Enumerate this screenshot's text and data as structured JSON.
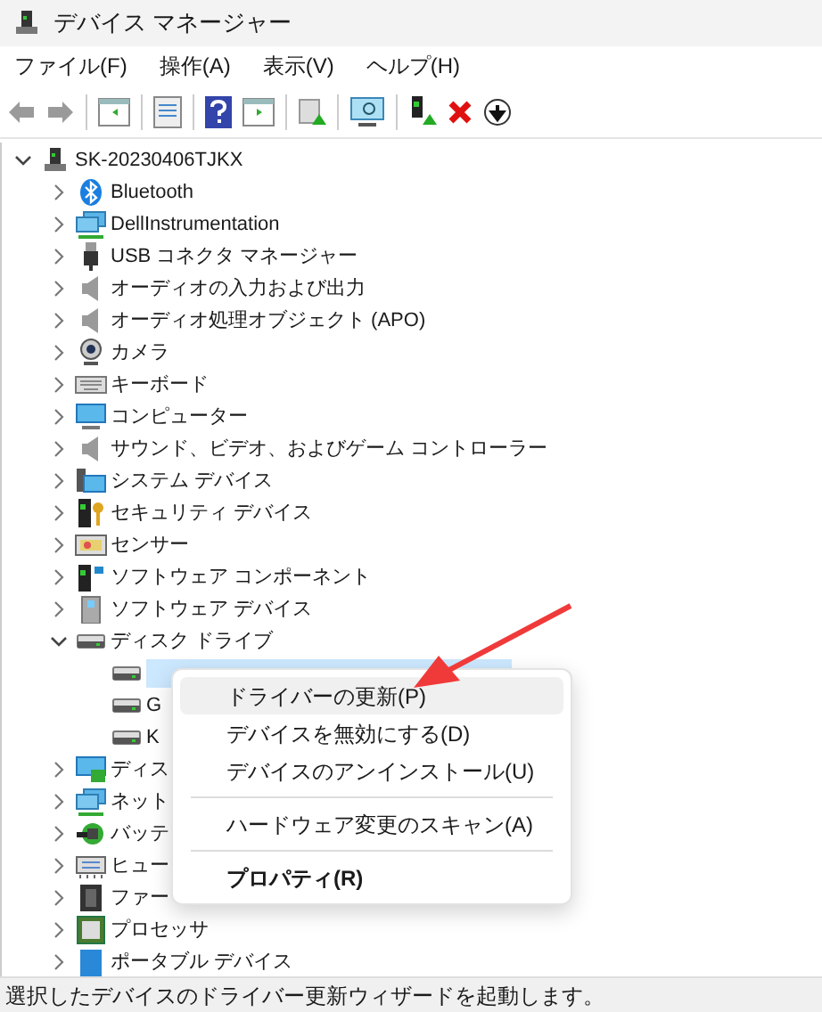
{
  "window": {
    "title": "デバイス マネージャー"
  },
  "menu_bar": [
    "ファイル(F)",
    "操作(A)",
    "表示(V)",
    "ヘルプ(H)"
  ],
  "tree": {
    "label": "SK-20230406TJKX",
    "expanded": true,
    "children": [
      {
        "label": "Bluetooth",
        "expanded": false
      },
      {
        "label": "DellInstrumentation",
        "expanded": false
      },
      {
        "label": "USB コネクタ マネージャー",
        "expanded": false
      },
      {
        "label": "オーディオの入力および出力",
        "expanded": false
      },
      {
        "label": "オーディオ処理オブジェクト (APO)",
        "expanded": false
      },
      {
        "label": "カメラ",
        "expanded": false
      },
      {
        "label": "キーボード",
        "expanded": false
      },
      {
        "label": "コンピューター",
        "expanded": false
      },
      {
        "label": "サウンド、ビデオ、およびゲーム コントローラー",
        "expanded": false
      },
      {
        "label": "システム デバイス",
        "expanded": false
      },
      {
        "label": "セキュリティ デバイス",
        "expanded": false
      },
      {
        "label": "センサー",
        "expanded": false
      },
      {
        "label": "ソフトウェア コンポーネント",
        "expanded": false
      },
      {
        "label": "ソフトウェア デバイス",
        "expanded": false
      },
      {
        "label": "ディスク ドライブ",
        "expanded": true,
        "children": [
          {
            "selected": true
          },
          {
            "label": "G",
            "selected": false
          },
          {
            "label": "K",
            "selected": false
          }
        ]
      },
      {
        "label": "ディス",
        "expanded": false
      },
      {
        "label": "ネット",
        "expanded": false
      },
      {
        "label": "バッテ",
        "expanded": false
      },
      {
        "label": "ヒュー",
        "expanded": false
      },
      {
        "label": "ファー",
        "expanded": false
      },
      {
        "label": "プロセッサ",
        "expanded": false
      },
      {
        "label": "ポータブル デバイス",
        "expanded": false
      }
    ]
  },
  "context_menu": [
    {
      "kind": "item",
      "label": "ドライバーの更新(P)",
      "selected": true
    },
    {
      "kind": "item",
      "label": "デバイスを無効にする(D)",
      "selected": false
    },
    {
      "kind": "item",
      "label": "デバイスのアンインストール(U)",
      "selected": false
    },
    {
      "kind": "separator"
    },
    {
      "kind": "item",
      "label": "ハードウェア変更のスキャン(A)",
      "selected": false
    },
    {
      "kind": "separator"
    },
    {
      "kind": "default",
      "label": "プロパティ(R)",
      "selected": false
    }
  ],
  "status_bar": "選択したデバイスのドライバー更新ウィザードを起動します。"
}
